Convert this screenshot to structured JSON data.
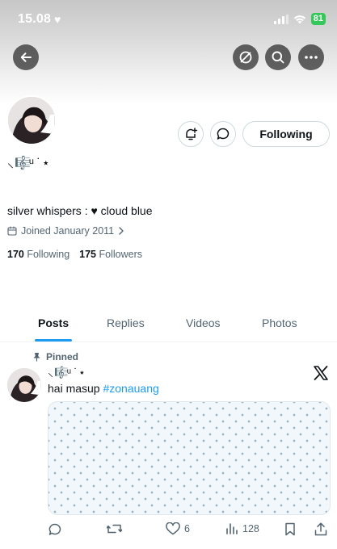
{
  "status_bar": {
    "time": "15.08",
    "battery": "81"
  },
  "profile": {
    "display_name": "⸜🎼ͧ ˙⋆",
    "bio": "silver whispers : ♥ cloud blue",
    "joined": "Joined January 2011",
    "following_count": "170",
    "following_label": "Following",
    "followers_count": "175",
    "followers_label": "Followers",
    "follow_button": "Following"
  },
  "tabs": [
    {
      "label": "Posts",
      "active": true
    },
    {
      "label": "Replies",
      "active": false
    },
    {
      "label": "Videos",
      "active": false
    },
    {
      "label": "Photos",
      "active": false
    }
  ],
  "pinned_post": {
    "pinned_label": "Pinned",
    "author_name": "⸜🎼ͧ ˙⋆",
    "text": "hai masup ",
    "hashtag": "#zonauang",
    "likes": "6",
    "views": "128"
  },
  "colors": {
    "accent": "#1d9bf0",
    "secondary_text": "#536471",
    "battery": "#34c759"
  },
  "icons": [
    "back-arrow-icon",
    "hide-icon",
    "search-icon",
    "more-icon",
    "notification-bell-icon",
    "message-icon",
    "calendar-icon",
    "chevron-right-icon",
    "pin-icon",
    "x-logo-icon",
    "reply-icon",
    "retweet-icon",
    "like-icon",
    "views-icon",
    "bookmark-icon",
    "share-icon"
  ]
}
